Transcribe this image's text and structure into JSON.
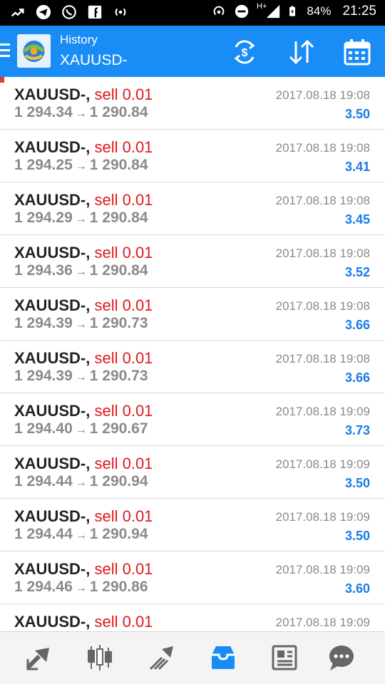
{
  "status_bar": {
    "battery": "84%",
    "time": "21:25",
    "network_label": "H+"
  },
  "app_bar": {
    "title": "History",
    "subtitle": "XAUUSD-",
    "colors": {
      "background": "#1a8cf5"
    }
  },
  "trades": [
    {
      "symbol": "XAUUSD-,",
      "action": "sell 0.01",
      "open": "1 294.34",
      "close": "1 290.84",
      "time": "2017.08.18 19:08",
      "profit": "3.50"
    },
    {
      "symbol": "XAUUSD-,",
      "action": "sell 0.01",
      "open": "1 294.25",
      "close": "1 290.84",
      "time": "2017.08.18 19:08",
      "profit": "3.41"
    },
    {
      "symbol": "XAUUSD-,",
      "action": "sell 0.01",
      "open": "1 294.29",
      "close": "1 290.84",
      "time": "2017.08.18 19:08",
      "profit": "3.45"
    },
    {
      "symbol": "XAUUSD-,",
      "action": "sell 0.01",
      "open": "1 294.36",
      "close": "1 290.84",
      "time": "2017.08.18 19:08",
      "profit": "3.52"
    },
    {
      "symbol": "XAUUSD-,",
      "action": "sell 0.01",
      "open": "1 294.39",
      "close": "1 290.73",
      "time": "2017.08.18 19:08",
      "profit": "3.66"
    },
    {
      "symbol": "XAUUSD-,",
      "action": "sell 0.01",
      "open": "1 294.39",
      "close": "1 290.73",
      "time": "2017.08.18 19:08",
      "profit": "3.66"
    },
    {
      "symbol": "XAUUSD-,",
      "action": "sell 0.01",
      "open": "1 294.40",
      "close": "1 290.67",
      "time": "2017.08.18 19:09",
      "profit": "3.73"
    },
    {
      "symbol": "XAUUSD-,",
      "action": "sell 0.01",
      "open": "1 294.44",
      "close": "1 290.94",
      "time": "2017.08.18 19:09",
      "profit": "3.50"
    },
    {
      "symbol": "XAUUSD-,",
      "action": "sell 0.01",
      "open": "1 294.44",
      "close": "1 290.94",
      "time": "2017.08.18 19:09",
      "profit": "3.50"
    },
    {
      "symbol": "XAUUSD-,",
      "action": "sell 0.01",
      "open": "1 294.46",
      "close": "1 290.86",
      "time": "2017.08.18 19:09",
      "profit": "3.60"
    },
    {
      "symbol": "XAUUSD-,",
      "action": "sell 0.01",
      "open": "",
      "close": "",
      "time": "2017.08.18 19:09",
      "profit": ""
    }
  ],
  "arrow_glyph": "→",
  "bottom_nav": [
    {
      "icon": "quotes-icon",
      "active": false
    },
    {
      "icon": "chart-icon",
      "active": false
    },
    {
      "icon": "trade-icon",
      "active": false
    },
    {
      "icon": "history-icon",
      "active": true
    },
    {
      "icon": "news-icon",
      "active": false
    },
    {
      "icon": "messages-icon",
      "active": false
    }
  ],
  "colors": {
    "sell": "#e0181c",
    "profit": "#1a7be8",
    "price": "#8a8a8a",
    "accent": "#1a8cf5"
  }
}
